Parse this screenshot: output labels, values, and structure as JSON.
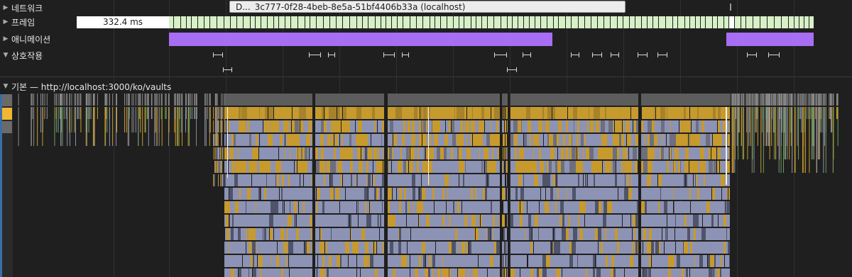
{
  "tracks": {
    "network_label": "네트워크",
    "frames_label": "프레임",
    "animation_label": "애니메이션",
    "interaction_label": "상호작용"
  },
  "network": {
    "request_prefix": "D...",
    "request_url": "3c777-0f28-4beb-8e5a-51bf4406b33a (localhost)"
  },
  "frames": {
    "selected_frame_duration": "332.4 ms"
  },
  "main_thread": {
    "label": "기본 — http://localhost:3000/ko/vaults"
  },
  "icons": {
    "expand": "triangle-right-icon",
    "collapse": "triangle-down-icon"
  },
  "colors": {
    "background": "#1f1f1f",
    "frame_idle": "#d7f0c8",
    "animation": "#a76ef3",
    "scripting": "#c79a2e",
    "rendering": "#8d93b4",
    "task_gray": "#5a5a5a",
    "stripe_yellow": "#f2b632"
  }
}
